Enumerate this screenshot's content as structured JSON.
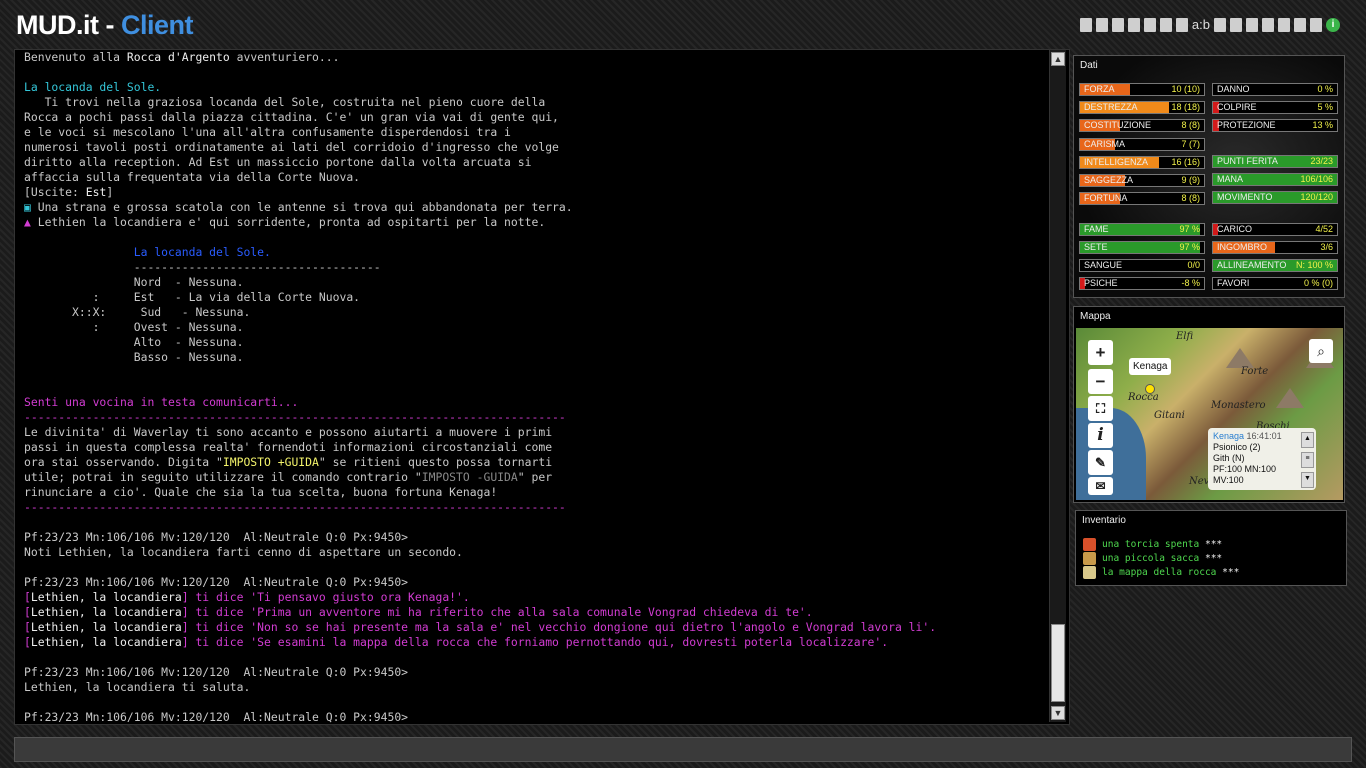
{
  "header": {
    "logo_left": "MUD.it - ",
    "logo_right": "Client",
    "toolbar_text": "a:b",
    "info_icon": "i"
  },
  "output_lines": [
    [
      {
        "t": "Benvenuto alla "
      },
      {
        "t": "Rocca d'Argento",
        "c": "wh"
      },
      {
        "t": " avventuriero..."
      }
    ],
    [
      {
        "t": ""
      }
    ],
    [
      {
        "t": "La locanda del Sole.",
        "c": "cy"
      }
    ],
    [
      {
        "t": "   Ti trovi nella graziosa locanda del Sole, costruita nel pieno cuore della"
      }
    ],
    [
      {
        "t": "Rocca a pochi passi dalla piazza cittadina. C'e' un gran via vai di gente qui,"
      }
    ],
    [
      {
        "t": "e le voci si mescolano l'una all'altra confusamente disperdendosi tra i"
      }
    ],
    [
      {
        "t": "numerosi tavoli posti ordinatamente ai lati del corridoio d'ingresso che volge"
      }
    ],
    [
      {
        "t": "diritto alla reception. Ad Est un massiccio portone dalla volta arcuata si"
      }
    ],
    [
      {
        "t": "affaccia sulla frequentata via della Corte Nuova."
      }
    ],
    [
      {
        "t": "[Uscite: "
      },
      {
        "t": "Est",
        "c": "wh"
      },
      {
        "t": "]"
      }
    ],
    [
      {
        "t": "▣ ",
        "c": "cy"
      },
      {
        "t": "Una strana e grossa scatola con le antenne si trova qui abbandonata per terra."
      }
    ],
    [
      {
        "t": "▲ ",
        "c": "mg"
      },
      {
        "t": "Lethien la locandiera e' qui sorridente, pronta ad ospitarti per la notte."
      }
    ],
    [
      {
        "t": ""
      }
    ],
    [
      {
        "t": "                La locanda del Sole.",
        "c": "bl"
      }
    ],
    [
      {
        "t": "                ------------------------------------"
      }
    ],
    [
      {
        "t": "                Nord  - Nessuna."
      }
    ],
    [
      {
        "t": "          :     Est   - La via della Corte Nuova."
      }
    ],
    [
      {
        "t": "       X::X:     Sud   - Nessuna."
      }
    ],
    [
      {
        "t": "          :     Ovest - Nessuna."
      }
    ],
    [
      {
        "t": "                Alto  - Nessuna."
      }
    ],
    [
      {
        "t": "                Basso - Nessuna."
      }
    ],
    [
      {
        "t": ""
      }
    ],
    [
      {
        "t": ""
      }
    ],
    [
      {
        "t": "Senti una vocina in testa comunicarti...",
        "c": "mg"
      }
    ],
    [
      {
        "t": "-------------------------------------------------------------------------------",
        "c": "mg"
      }
    ],
    [
      {
        "t": "Le divinita' di Waverlay ti sono accanto e possono aiutarti a muovere i primi"
      }
    ],
    [
      {
        "t": "passi in questa complessa realta' fornendoti informazioni circostanziali come"
      }
    ],
    [
      {
        "t": "ora stai osservando. Digita \""
      },
      {
        "t": "IMPOSTO +GUIDA",
        "c": "ye"
      },
      {
        "t": "\" se ritieni questo possa tornarti"
      }
    ],
    [
      {
        "t": "utile; potrai in seguito utilizzare il comando contrario \""
      },
      {
        "t": "IMPOSTO -GUIDA",
        "c": "gr"
      },
      {
        "t": "\" per"
      }
    ],
    [
      {
        "t": "rinunciare a cio'. Quale che sia la tua scelta, buona fortuna Kenaga!"
      }
    ],
    [
      {
        "t": "-------------------------------------------------------------------------------",
        "c": "mg"
      }
    ],
    [
      {
        "t": ""
      }
    ],
    [
      {
        "t": "Pf:23/23 Mn:106/106 Mv:120/120  Al:Neutrale Q:0 Px:9450>"
      }
    ],
    [
      {
        "t": "Noti Lethien, la locandiera farti cenno di aspettare un secondo."
      }
    ],
    [
      {
        "t": ""
      }
    ],
    [
      {
        "t": "Pf:23/23 Mn:106/106 Mv:120/120  Al:Neutrale Q:0 Px:9450>"
      }
    ],
    [
      {
        "t": "[",
        "c": "mg"
      },
      {
        "t": "Lethien, la locandiera",
        "c": "wh"
      },
      {
        "t": "] ti dice 'Ti pensavo giusto ora Kenaga!'.",
        "c": "mg"
      }
    ],
    [
      {
        "t": "[",
        "c": "mg"
      },
      {
        "t": "Lethien, la locandiera",
        "c": "wh"
      },
      {
        "t": "] ti dice 'Prima un avventore mi ha riferito che alla sala comunale Vongrad chiedeva di te'.",
        "c": "mg"
      }
    ],
    [
      {
        "t": "[",
        "c": "mg"
      },
      {
        "t": "Lethien, la locandiera",
        "c": "wh"
      },
      {
        "t": "] ti dice 'Non so se hai presente ma la sala e' nel vecchio dongione qui dietro l'angolo e Vongrad lavora li'.",
        "c": "mg"
      }
    ],
    [
      {
        "t": "[",
        "c": "mg"
      },
      {
        "t": "Lethien, la locandiera",
        "c": "wh"
      },
      {
        "t": "] ti dice 'Se esamini la mappa della rocca che forniamo pernottando qui, dovresti poterla localizzare'.",
        "c": "mg"
      }
    ],
    [
      {
        "t": ""
      }
    ],
    [
      {
        "t": "Pf:23/23 Mn:106/106 Mv:120/120  Al:Neutrale Q:0 Px:9450>"
      }
    ],
    [
      {
        "t": "Lethien, la locandiera ti saluta."
      }
    ],
    [
      {
        "t": ""
      }
    ],
    [
      {
        "t": "Pf:23/23 Mn:106/106 Mv:120/120  Al:Neutrale Q:0 Px:9450>"
      }
    ]
  ],
  "dati": {
    "title": "Dati",
    "left": [
      {
        "name": "FORZA",
        "value": "10 (10)",
        "fill": 0.4,
        "color": "#e8661a"
      },
      {
        "name": "DESTREZZA",
        "value": "18 (18)",
        "fill": 0.72,
        "color": "#f08a1a"
      },
      {
        "name": "COSTITUZIONE",
        "value": "8 (8)",
        "fill": 0.32,
        "color": "#e8661a"
      },
      {
        "name": "CARISMA",
        "value": "7 (7)",
        "fill": 0.28,
        "color": "#e8661a"
      },
      {
        "name": "INTELLIGENZA",
        "value": "16 (16)",
        "fill": 0.64,
        "color": "#f08a1a"
      },
      {
        "name": "SAGGEZZA",
        "value": "9 (9)",
        "fill": 0.36,
        "color": "#e8661a"
      },
      {
        "name": "FORTUNA",
        "value": "8 (8)",
        "fill": 0.32,
        "color": "#e8661a"
      },
      {
        "name": "FAME",
        "value": "97 %",
        "fill": 0.97,
        "color": "#2a9a2a"
      },
      {
        "name": "SETE",
        "value": "97 %",
        "fill": 0.97,
        "color": "#2a9a2a"
      },
      {
        "name": "SANGUE",
        "value": "0/0",
        "fill": 0,
        "color": "#2a9a2a"
      },
      {
        "name": "PSICHE",
        "value": "-8 %",
        "fill": 0.04,
        "color": "#d21a1a"
      }
    ],
    "right": [
      {
        "name": "DANNO",
        "value": "0 %",
        "fill": 0,
        "color": "#d21a1a"
      },
      {
        "name": "COLPIRE",
        "value": "5 %",
        "fill": 0.05,
        "color": "#d21a1a"
      },
      {
        "name": "PROTEZIONE",
        "value": "13 %",
        "fill": 0.05,
        "color": "#d21a1a"
      },
      {
        "name": "PUNTI FERITA",
        "value": "23/23",
        "fill": 1,
        "color": "#2a9a2a"
      },
      {
        "name": "MANA",
        "value": "106/106",
        "fill": 1,
        "color": "#2a9a2a"
      },
      {
        "name": "MOVIMENTO",
        "value": "120/120",
        "fill": 1,
        "color": "#2a9a2a"
      },
      {
        "name": "CARICO",
        "value": "4/52",
        "fill": 0.04,
        "color": "#d21a1a"
      },
      {
        "name": "INGOMBRO",
        "value": "3/6",
        "fill": 0.5,
        "color": "#e8661a"
      },
      {
        "name": "ALLINEAMENTO",
        "value": "N: 100 %",
        "fill": 1,
        "color": "#2a9a2a"
      },
      {
        "name": "FAVORI",
        "value": "0 % (0)",
        "fill": 0,
        "color": "#2a9a2a"
      }
    ]
  },
  "mappa": {
    "title": "Mappa",
    "tooltip": "Kenaga",
    "labels": [
      "Elfi",
      "Forte",
      "Rocca",
      "Monastero",
      "Gitani",
      "Boschi",
      "Neve"
    ],
    "popup": {
      "name": "Kenaga",
      "time": "16:41:01",
      "l1": "Psionico (2)",
      "l2": "Gith (N)",
      "l3": "PF:100 MN:100",
      "l4": "MV:100"
    }
  },
  "inventario": {
    "title": "Inventario",
    "items": [
      {
        "name": "una torcia spenta",
        "stars": "***",
        "color": "#d8502a"
      },
      {
        "name": "una piccola sacca",
        "stars": "***",
        "color": "#c89a4a"
      },
      {
        "name": "la mappa della rocca",
        "stars": "***",
        "color": "#d8c88a"
      }
    ]
  }
}
